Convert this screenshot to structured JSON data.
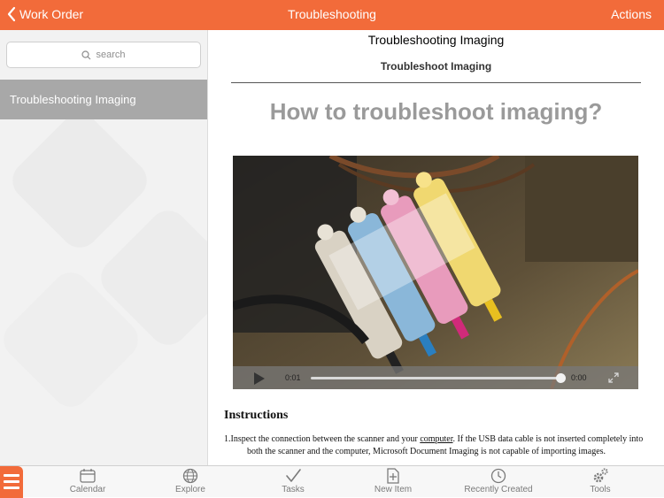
{
  "header": {
    "back_label": "Work Order",
    "title": "Troubleshooting",
    "actions_label": "Actions"
  },
  "sidebar": {
    "search_placeholder": "search",
    "items": [
      {
        "label": "Troubleshooting Imaging",
        "selected": true
      }
    ]
  },
  "content": {
    "doc_title": "Troubleshooting Imaging",
    "doc_subtitle": "Troubleshoot Imaging",
    "heading": "How to troubleshoot imaging?",
    "video": {
      "current_time": "0:01",
      "end_time": "0:00",
      "progress": 0.98
    },
    "instructions_heading": "Instructions",
    "instructions": [
      {
        "number": "1.",
        "text_before_link": "Inspect the connection between the scanner and your ",
        "link_text": "computer",
        "text_after_link": ". If the USB data cable is not inserted completely into",
        "continuation": "both the scanner and the computer, Microsoft Document Imaging is not capable of importing images."
      }
    ]
  },
  "tabbar": {
    "tabs": [
      {
        "label": "Calendar",
        "icon": "calendar-icon"
      },
      {
        "label": "Explore",
        "icon": "globe-icon"
      },
      {
        "label": "Tasks",
        "icon": "checkmark-icon"
      },
      {
        "label": "New Item",
        "icon": "new-document-icon"
      },
      {
        "label": "Recently Created",
        "icon": "clock-icon"
      },
      {
        "label": "Tools",
        "icon": "gears-icon"
      }
    ]
  },
  "colors": {
    "accent": "#f26b3a",
    "sidebar_selected": "#a8a8a8",
    "heading_gray": "#9a9a9a"
  }
}
